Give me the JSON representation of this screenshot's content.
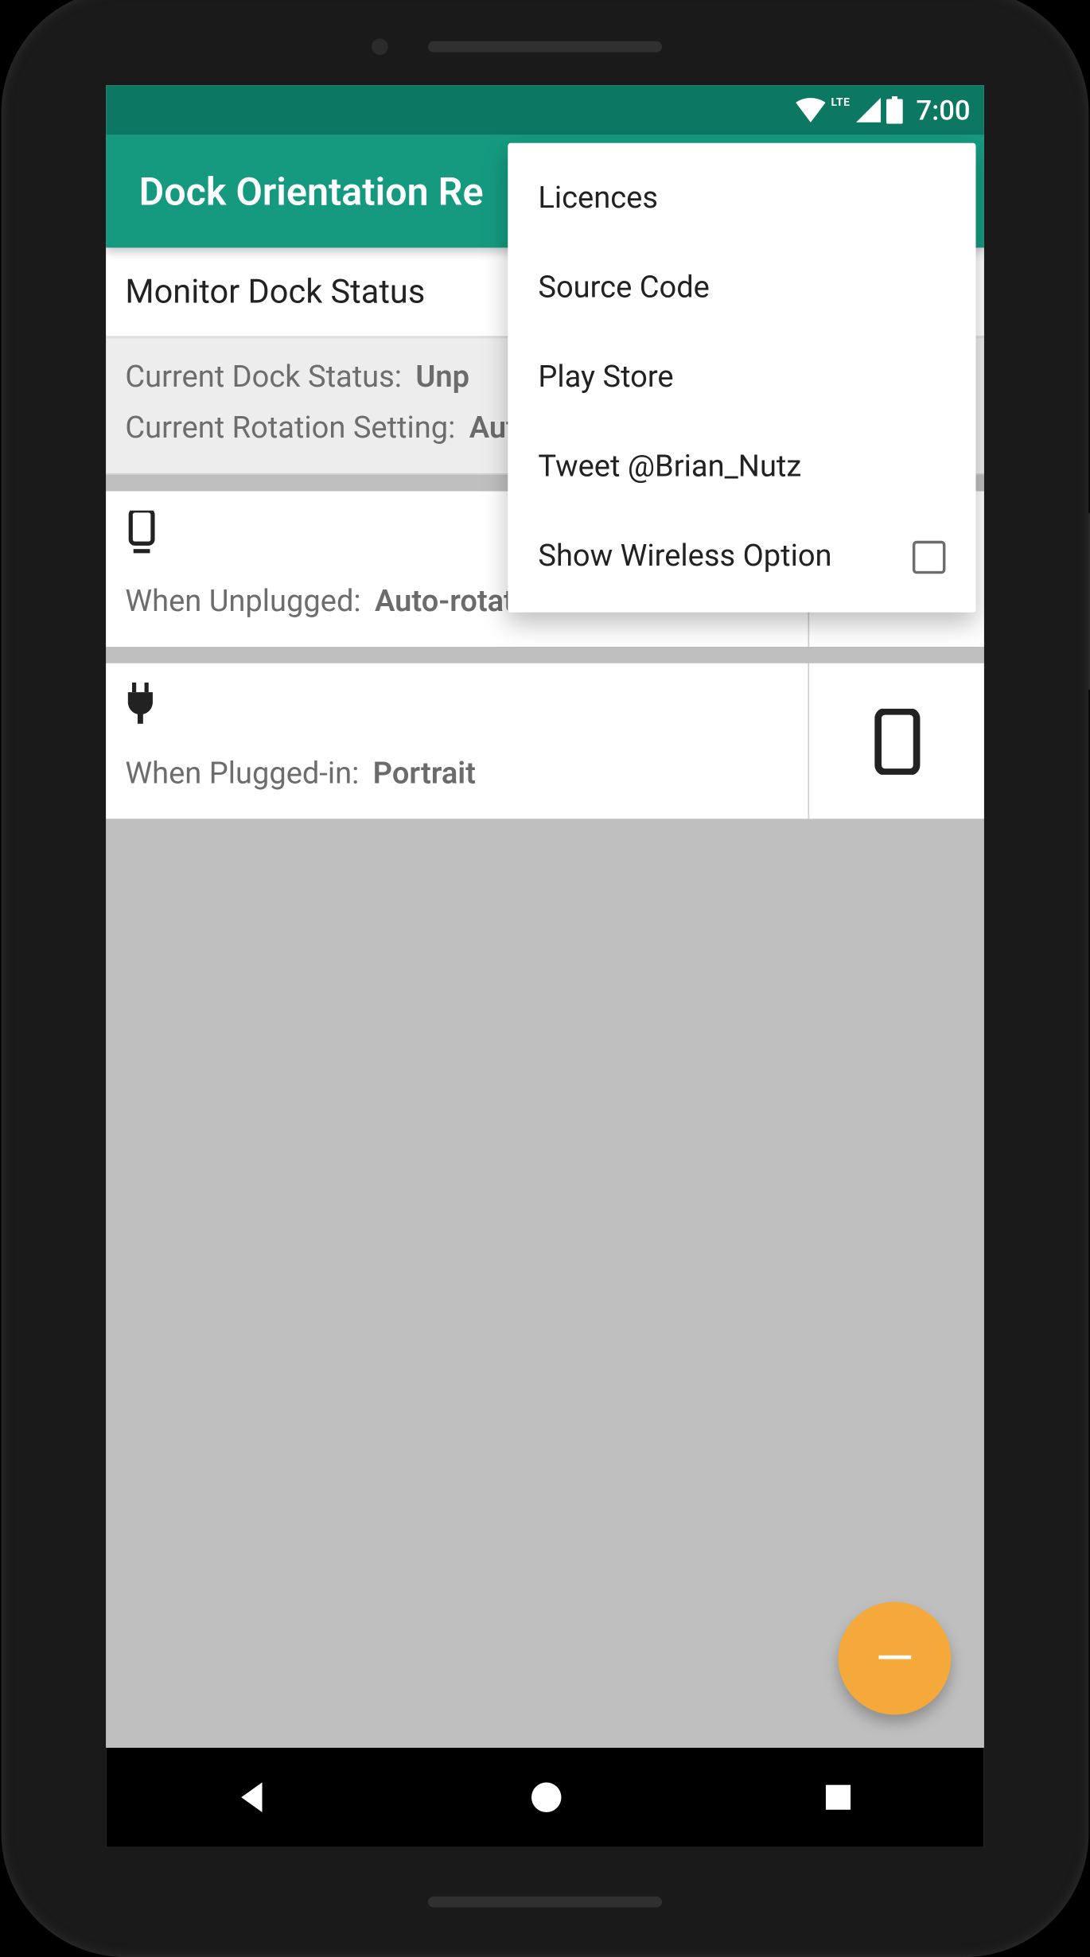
{
  "status_bar": {
    "time": "7:00"
  },
  "app_bar": {
    "title": "Dock Orientation Re"
  },
  "cards": {
    "monitor_header": "Monitor Dock Status",
    "current_dock_label": "Current Dock Status:",
    "current_dock_value": "Unp",
    "current_rotation_label": "Current Rotation Setting:",
    "current_rotation_value": "Aut"
  },
  "settings": [
    {
      "label": "When Unplugged:",
      "value": "Auto-rotate"
    },
    {
      "label": "When Plugged-in:",
      "value": "Portrait"
    }
  ],
  "fab": {
    "glyph": "—"
  },
  "popup": {
    "items": [
      "Licences",
      "Source Code",
      "Play Store",
      "Tweet @Brian_Nutz"
    ],
    "checkbox_label": "Show Wireless Option"
  }
}
